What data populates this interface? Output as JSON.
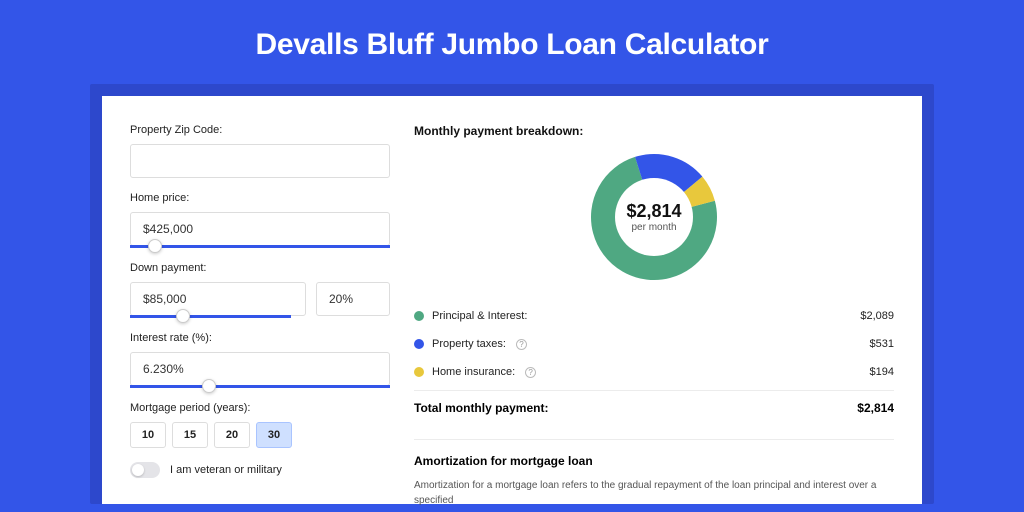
{
  "title": "Devalls Bluff Jumbo Loan Calculator",
  "form": {
    "zip_label": "Property Zip Code:",
    "zip_value": "",
    "home_label": "Home price:",
    "home_value": "$425,000",
    "down_label": "Down payment:",
    "down_value": "$85,000",
    "down_pct": "20%",
    "rate_label": "Interest rate (%):",
    "rate_value": "6.230%",
    "period_label": "Mortgage period (years):",
    "periods": [
      "10",
      "15",
      "20",
      "30"
    ],
    "period_selected": "30",
    "veteran_label": "I am veteran or military"
  },
  "breakdown": {
    "title": "Monthly payment breakdown:",
    "amount": "$2,814",
    "sub": "per month",
    "items": [
      {
        "label": "Principal & Interest:",
        "value": "$2,089",
        "color": "green",
        "info": false
      },
      {
        "label": "Property taxes:",
        "value": "$531",
        "color": "blue",
        "info": true
      },
      {
        "label": "Home insurance:",
        "value": "$194",
        "color": "yellow",
        "info": true
      }
    ],
    "total_label": "Total monthly payment:",
    "total_value": "$2,814"
  },
  "chart_data": {
    "type": "pie",
    "title": "Monthly payment breakdown",
    "series": [
      {
        "name": "Principal & Interest",
        "value": 2089,
        "color": "#4fa882"
      },
      {
        "name": "Property taxes",
        "value": 531,
        "color": "#3355e8"
      },
      {
        "name": "Home insurance",
        "value": 194,
        "color": "#e8c83c"
      }
    ],
    "total": 2814,
    "center_label": "$2,814",
    "center_sub": "per month"
  },
  "amort": {
    "title": "Amortization for mortgage loan",
    "text": "Amortization for a mortgage loan refers to the gradual repayment of the loan principal and interest over a specified"
  }
}
